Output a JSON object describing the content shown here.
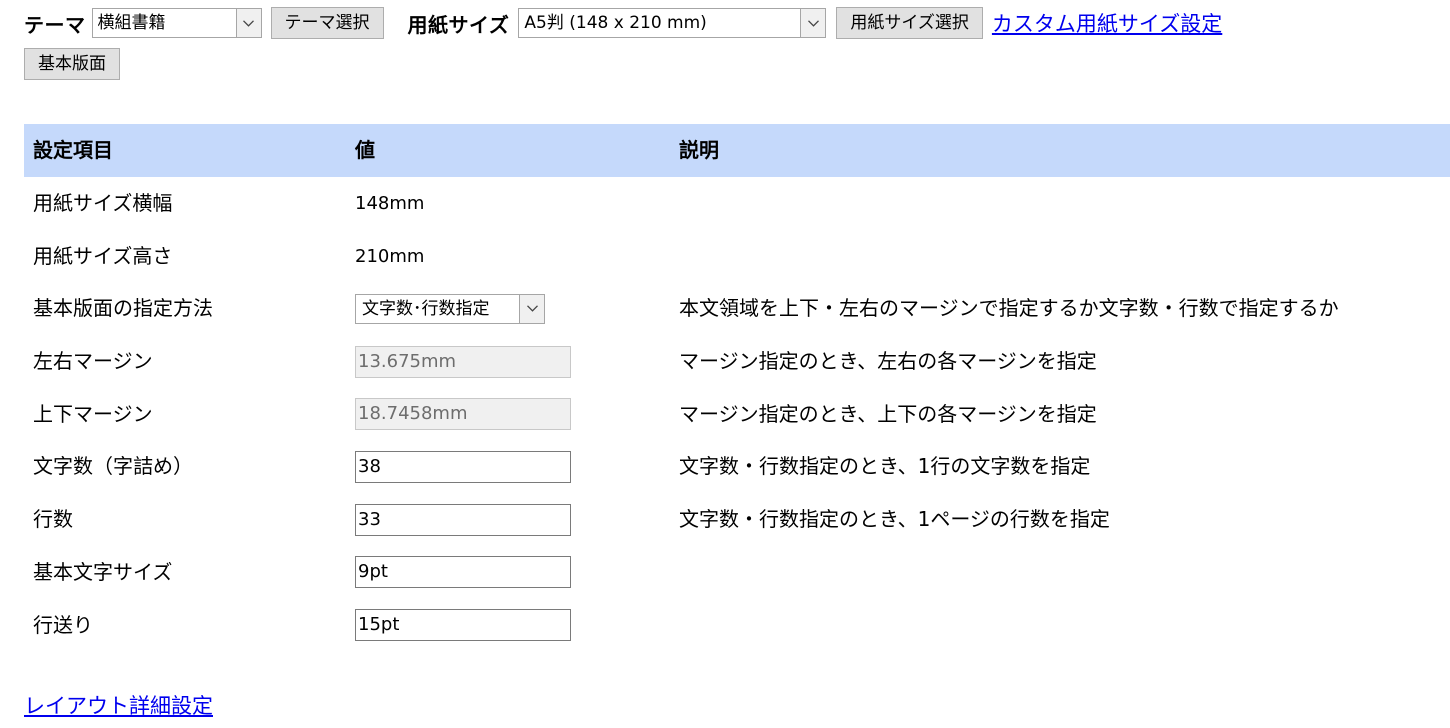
{
  "toolbar": {
    "theme_label": "テーマ",
    "theme_select_value": "横組書籍",
    "theme_button": "テーマ選択",
    "paper_label": "用紙サイズ",
    "paper_select_value": "A5判 (148 x 210 mm)",
    "paper_button": "用紙サイズ選択",
    "custom_paper_link": "カスタム用紙サイズ設定",
    "basic_layout_button": "基本版面"
  },
  "table": {
    "headers": [
      "設定項目",
      "値",
      "説明"
    ],
    "rows": [
      {
        "name": "用紙サイズ横幅",
        "value": "148mm",
        "desc": ""
      },
      {
        "name": "用紙サイズ高さ",
        "value": "210mm",
        "desc": ""
      },
      {
        "name": "基本版面の指定方法",
        "value": "文字数･行数指定",
        "desc": "本文領域を上下・左右のマージンで指定するか文字数・行数で指定するか"
      },
      {
        "name": "左右マージン",
        "value": "13.675mm",
        "desc": "マージン指定のとき、左右の各マージンを指定"
      },
      {
        "name": "上下マージン",
        "value": "18.7458mm",
        "desc": "マージン指定のとき、上下の各マージンを指定"
      },
      {
        "name": "文字数（字詰め）",
        "value": "38",
        "desc": "文字数・行数指定のとき、1行の文字数を指定"
      },
      {
        "name": "行数",
        "value": "33",
        "desc": "文字数・行数指定のとき、1ページの行数を指定"
      },
      {
        "name": "基本文字サイズ",
        "value": "9pt",
        "desc": ""
      },
      {
        "name": "行送り",
        "value": "15pt",
        "desc": ""
      }
    ]
  },
  "footer": {
    "layout_detail_link": "レイアウト詳細設定"
  },
  "colors": {
    "header_bg": "#c5d9fb",
    "link": "#0000ee"
  }
}
